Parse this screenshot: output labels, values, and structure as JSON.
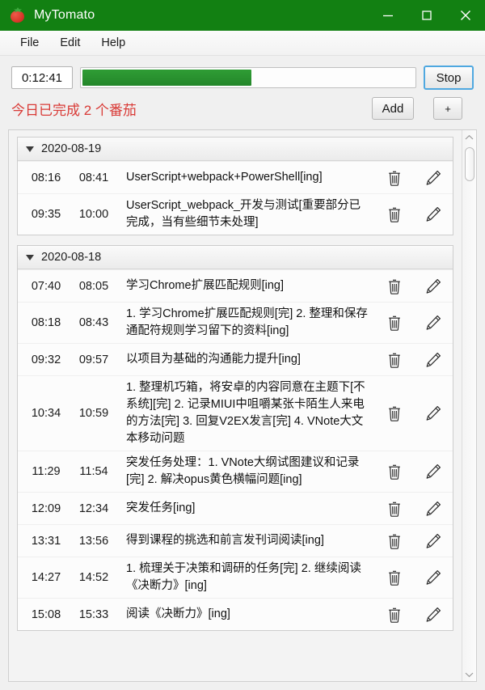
{
  "window": {
    "title": "MyTomato",
    "icon": "tomato-icon",
    "accent_green": "#128012",
    "controls": {
      "minimize": "minimize-icon",
      "maximize": "maximize-icon",
      "close": "close-icon"
    }
  },
  "menubar": {
    "items": [
      {
        "label": "File"
      },
      {
        "label": "Edit"
      },
      {
        "label": "Help"
      }
    ]
  },
  "toolbar": {
    "timer_value": "0:12:41",
    "progress_percent": 51,
    "progress_color": "#24862a",
    "stop_label": "Stop",
    "today_summary": "今日已完成 2 个番茄",
    "today_summary_color": "#d93a36",
    "add_label": "Add",
    "plus_label": "+"
  },
  "list": {
    "groups": [
      {
        "date": "2020-08-19",
        "collapsed": false,
        "entries": [
          {
            "start": "08:16",
            "end": "08:41",
            "task": "UserScript+webpack+PowerShell[ing]"
          },
          {
            "start": "09:35",
            "end": "10:00",
            "task": "UserScript_webpack_开发与测试[重要部分已完成，当有些细节未处理]"
          }
        ]
      },
      {
        "date": "2020-08-18",
        "collapsed": false,
        "entries": [
          {
            "start": "07:40",
            "end": "08:05",
            "task": "学习Chrome扩展匹配规则[ing]"
          },
          {
            "start": "08:18",
            "end": "08:43",
            "task": "1. 学习Chrome扩展匹配规则[完] 2. 整理和保存通配符规则学习留下的资料[ing]"
          },
          {
            "start": "09:32",
            "end": "09:57",
            "task": "以项目为基础的沟通能力提升[ing]"
          },
          {
            "start": "10:34",
            "end": "10:59",
            "task": "1. 整理机巧箱，将安卓的内容同意在主题下[不系统][完] 2. 记录MIUI中咀嚼某张卡陌生人来电的方法[完] 3. 回复V2EX发言[完] 4. VNote大文本移动问题"
          },
          {
            "start": "11:29",
            "end": "11:54",
            "task": "突发任务处理：1. VNote大纲试图建议和记录[完] 2. 解决opus黄色横幅问题[ing]"
          },
          {
            "start": "12:09",
            "end": "12:34",
            "task": "突发任务[ing]"
          },
          {
            "start": "13:31",
            "end": "13:56",
            "task": "得到课程的挑选和前言发刊词阅读[ing]"
          },
          {
            "start": "14:27",
            "end": "14:52",
            "task": "1. 梳理关于决策和调研的任务[完] 2. 继续阅读《决断力》[ing]"
          },
          {
            "start": "15:08",
            "end": "15:33",
            "task": "阅读《决断力》[ing]"
          }
        ]
      }
    ],
    "row_icons": {
      "delete": "trash-icon",
      "edit": "pencil-icon"
    }
  },
  "scrollbar": {
    "up": "chevron-up-icon",
    "down": "chevron-down-icon",
    "thumb": "scrollbar-thumb"
  }
}
